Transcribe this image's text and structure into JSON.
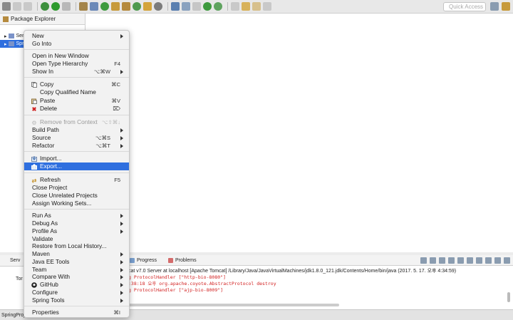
{
  "toolbar": {
    "quick_access_placeholder": "Quick Access"
  },
  "package_explorer": {
    "tab_label": "Package Explorer",
    "tree": [
      {
        "label": "Ser"
      },
      {
        "label": "Spr"
      }
    ]
  },
  "context_menu": {
    "items": {
      "new": {
        "label": "New"
      },
      "go_into": {
        "label": "Go Into"
      },
      "open_new_window": {
        "label": "Open in New Window"
      },
      "open_type_hierarchy": {
        "label": "Open Type Hierarchy",
        "shortcut": "F4"
      },
      "show_in": {
        "label": "Show In",
        "shortcut": "⌥⌘W"
      },
      "copy": {
        "label": "Copy",
        "shortcut": "⌘C"
      },
      "copy_qualified_name": {
        "label": "Copy Qualified Name"
      },
      "paste": {
        "label": "Paste",
        "shortcut": "⌘V"
      },
      "delete": {
        "label": "Delete",
        "shortcut": "⌦"
      },
      "remove_from_context": {
        "label": "Remove from Context",
        "shortcut": "⌥⇧⌘↓"
      },
      "build_path": {
        "label": "Build Path"
      },
      "source": {
        "label": "Source",
        "shortcut": "⌥⌘S"
      },
      "refactor": {
        "label": "Refactor",
        "shortcut": "⌥⌘T"
      },
      "import": {
        "label": "Import..."
      },
      "export": {
        "label": "Export..."
      },
      "refresh": {
        "label": "Refresh",
        "shortcut": "F5"
      },
      "close_project": {
        "label": "Close Project"
      },
      "close_unrelated": {
        "label": "Close Unrelated Projects"
      },
      "assign_working_sets": {
        "label": "Assign Working Sets..."
      },
      "run_as": {
        "label": "Run As"
      },
      "debug_as": {
        "label": "Debug As"
      },
      "profile_as": {
        "label": "Profile As"
      },
      "validate": {
        "label": "Validate"
      },
      "restore_history": {
        "label": "Restore from Local History..."
      },
      "maven": {
        "label": "Maven"
      },
      "java_ee_tools": {
        "label": "Java EE Tools"
      },
      "team": {
        "label": "Team"
      },
      "compare_with": {
        "label": "Compare With"
      },
      "github": {
        "label": "GitHub"
      },
      "configure": {
        "label": "Configure"
      },
      "spring_tools": {
        "label": "Spring Tools"
      },
      "properties": {
        "label": "Properties",
        "shortcut": "⌘I"
      }
    }
  },
  "servers_view": {
    "tab_label": "Serv",
    "row_label": "Tor"
  },
  "console": {
    "tabs": [
      {
        "label": "Progress"
      },
      {
        "label": "Problems"
      }
    ],
    "header": "cat v7.0 Server at localhost [Apache Tomcat] /Library/Java/JavaVirtualMachines/jdk1.8.0_121.jdk/Contents/Home/bin/java (2017. 5. 17. 오후 4:34:59)",
    "lines": [
      "g ProtocolHandler [\"http-bio-8080\"]",
      ":38:18 오후 org.apache.coyote.AbstractProtocol destroy",
      "g ProtocolHandler [\"ajp-bio-8009\"]"
    ]
  },
  "status_bar": {
    "text": "SpringProj"
  }
}
